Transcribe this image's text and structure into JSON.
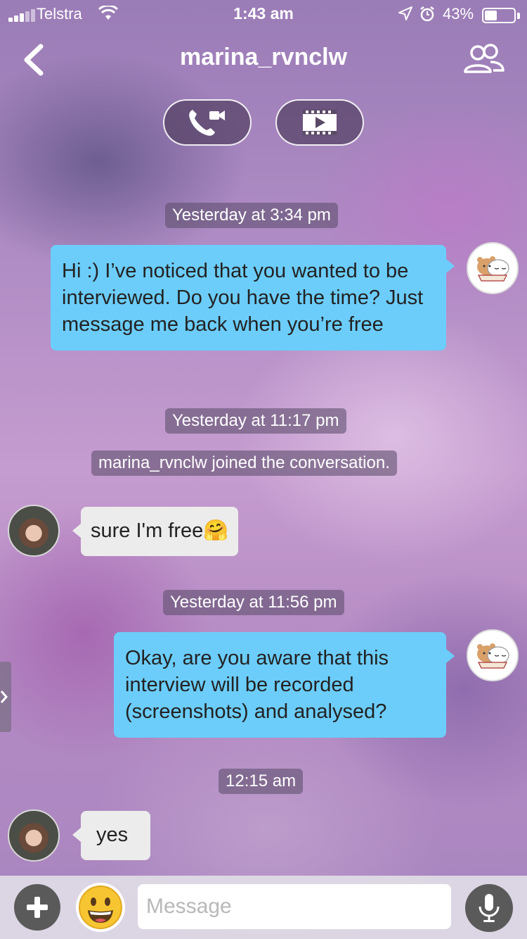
{
  "status_bar": {
    "carrier": "Telstra",
    "time": "1:43 am",
    "battery_percent": "43%",
    "battery_level": 0.43
  },
  "header": {
    "title": "marina_rvnclw",
    "icons": [
      "back-chevron-icon",
      "members-icon",
      "voice-video-call-icon",
      "screening-room-icon"
    ]
  },
  "messages": {
    "stamp_1": "Yesterday at 3:34 pm",
    "msg_1": "Hi :) I’ve noticed that you wanted to be interviewed. Do you have the time? Just message me back when you’re free",
    "stamp_2": "Yesterday at 11:17 pm",
    "system_1": "marina_rvnclw joined the conversation.",
    "msg_2": "sure I'm free",
    "msg_2_emoji": "🤗",
    "stamp_3": "Yesterday at 11:56 pm",
    "msg_3": "Okay, are you aware that this interview will be recorded (screenshots) and analysed?",
    "stamp_4": "12:15 am",
    "msg_4": "yes"
  },
  "composer": {
    "placeholder": "Message"
  },
  "colors": {
    "outgoing_bubble": "#6ccdfa",
    "incoming_bubble": "#ececec",
    "stamp_bg": "#5f506e"
  }
}
